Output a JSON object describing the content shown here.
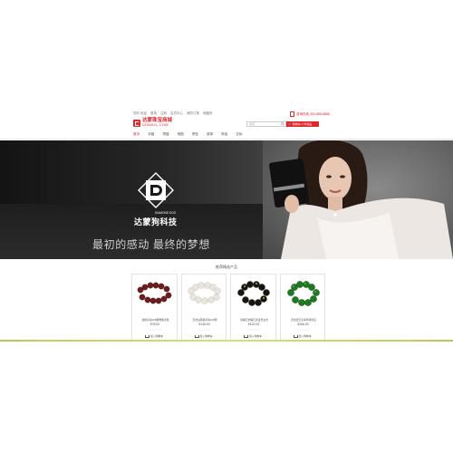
{
  "top_links": [
    "您好,欢迎",
    "登录",
    "注册",
    "会员中心",
    "我的订单",
    "收藏夹"
  ],
  "header": {
    "logo_cn": "达蒙珠宝商城",
    "logo_en": "DDMALL.COM",
    "hotline": "咨询热线 400-888-8888",
    "search_placeholder": "搜索",
    "cart_label": "购物车 0 件商品"
  },
  "nav": [
    "首页",
    "手链",
    "项链",
    "戒指",
    "吊坠",
    "耳饰",
    "饰品",
    "文玩"
  ],
  "banner": {
    "brand_en": "DIAMOND DOG",
    "brand_cn": "达蒙狗科技",
    "slogan": "最初的感动 最终的梦想"
  },
  "section_title": "推荐精选产品",
  "products": [
    {
      "name": "紫檀手串108颗佛珠念珠",
      "price": "¥78.00",
      "stars": "☆☆☆☆☆",
      "cart": "加入购物车"
    },
    {
      "name": "天然白砗磲手串108颗",
      "price": "¥146.00",
      "stars": "☆☆☆☆☆",
      "cart": "加入购物车"
    },
    {
      "name": "黑曜石金曜石手链男女款",
      "price": "¥120.00",
      "stars": "☆☆☆☆☆",
      "cart": "加入购物车"
    },
    {
      "name": "天然碧玉手串翠绿手链",
      "price": "¥266.00",
      "stars": "☆☆☆☆☆",
      "cart": "加入购物车"
    }
  ],
  "colors": {
    "accent": "#e0262b",
    "banner_dark": "#1a1a1a",
    "footer_line": "#c8d46a"
  }
}
